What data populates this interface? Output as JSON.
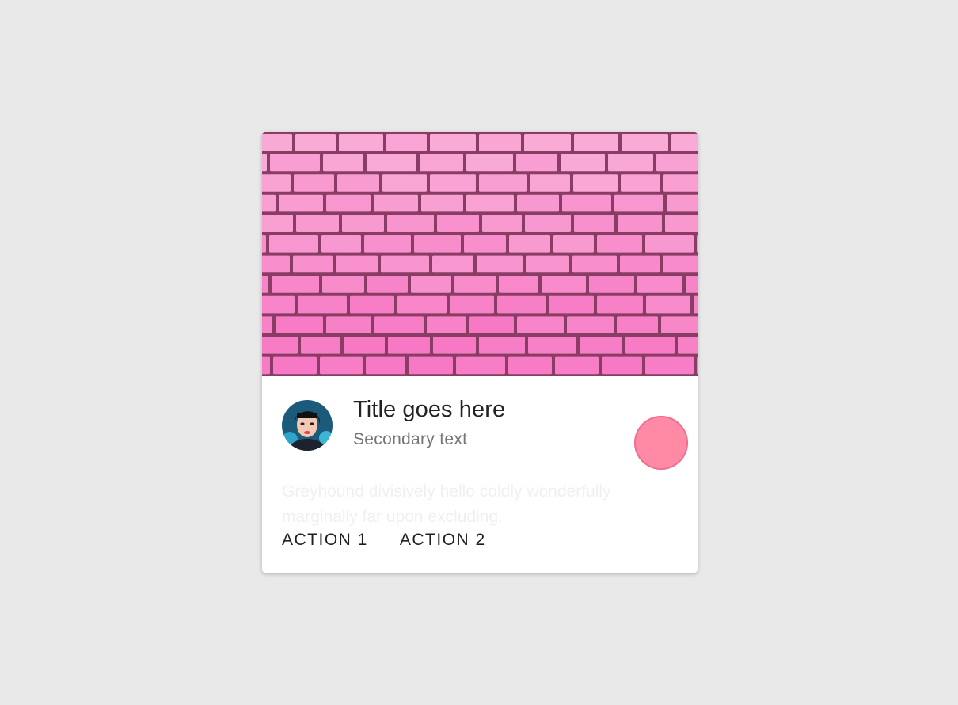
{
  "card": {
    "title": "Title goes here",
    "subtitle": "Secondary text",
    "body": "Greyhound divisively hello coldly wonderfully marginally far upon excluding.",
    "actions": [
      "ACTION 1",
      "ACTION 2"
    ],
    "media": {
      "icon": "brick-wall-image",
      "color": "#f79ccd"
    },
    "avatar": {
      "icon": "person-portrait"
    },
    "fab": {
      "icon": "pink-circle-button",
      "color": "#ff8aa6"
    }
  }
}
